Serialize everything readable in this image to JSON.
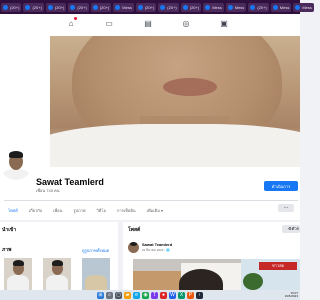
{
  "browser": {
    "tabs": [
      {
        "label": "(20+)",
        "icon": "facebook-icon"
      },
      {
        "label": "(20+)",
        "icon": "facebook-icon"
      },
      {
        "label": "(20+)",
        "icon": "facebook-icon"
      },
      {
        "label": "(20+)",
        "icon": "facebook-icon"
      },
      {
        "label": "(20+)",
        "icon": "facebook-icon"
      },
      {
        "label": "Mess",
        "icon": "facebook-icon"
      },
      {
        "label": "(20+)",
        "icon": "facebook-icon"
      },
      {
        "label": "(20+)",
        "icon": "facebook-icon"
      },
      {
        "label": "(20+)",
        "icon": "facebook-icon"
      },
      {
        "label": "Mess",
        "icon": "facebook-icon"
      },
      {
        "label": "Mess",
        "icon": "facebook-icon"
      },
      {
        "label": "(20+)",
        "icon": "facebook-icon"
      },
      {
        "label": "Mess",
        "icon": "facebook-icon"
      },
      {
        "label": "Mess",
        "icon": "facebook-icon"
      }
    ]
  },
  "navbar": {
    "icons": [
      "home-icon",
      "watch-icon",
      "marketplace-icon",
      "groups-icon",
      "gaming-icon"
    ],
    "notification_dot_color": "#e41e3f"
  },
  "profile": {
    "name": "Sawat Teamlerd",
    "followers": "เพื่อน 745 คน",
    "edit_button": "ดำเนินการ",
    "tabs": [
      "โพสต์",
      "เกี่ยวกับ",
      "เพื่อน",
      "รูปภาพ",
      "วิดีโอ",
      "การเช็คอิน",
      "เพิ่มเติม ▾"
    ],
    "more_button": "···"
  },
  "intro_card": {
    "title": "ภาพ",
    "header_partial": "นำเข้า",
    "link": "ดูรูปภาพทั้งหมด"
  },
  "posts_card": {
    "title": "โพสต์",
    "filter_button": "ตัวก",
    "post": {
      "author": "Sawat Teamlerd",
      "time": "22 มีนาคม 2023 · 🌐"
    },
    "image_sign": "ข่าวสด"
  },
  "taskbar": {
    "time": "15:07",
    "date": "19/5/2023"
  },
  "colors": {
    "facebook_blue": "#1877f2",
    "browser_frame": "#2f0f3e",
    "page_bg": "#f0f2f5"
  }
}
